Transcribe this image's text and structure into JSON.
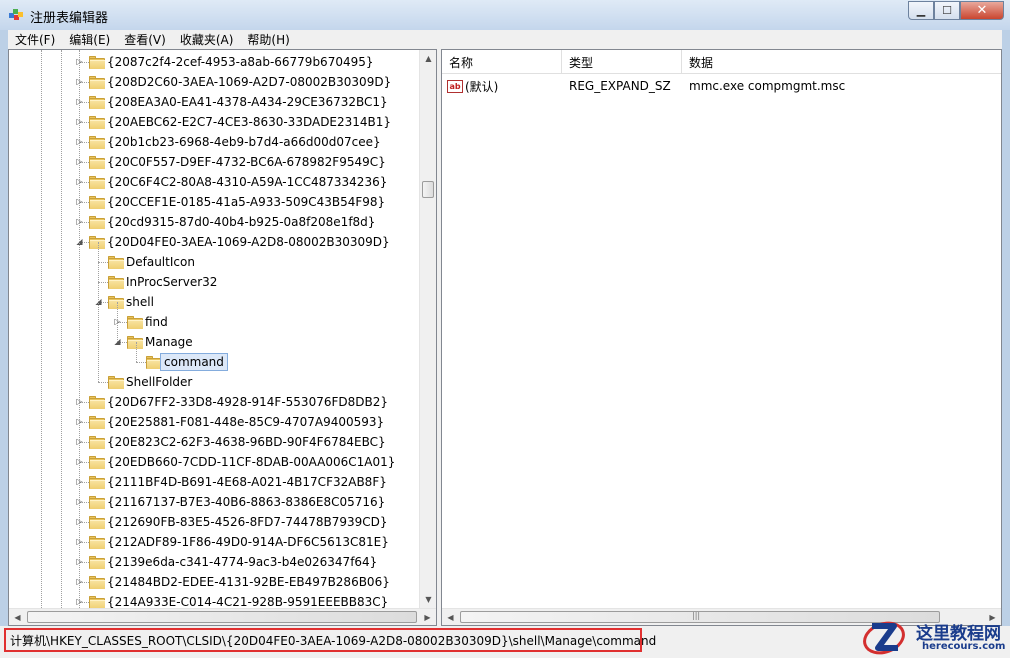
{
  "window": {
    "title": "注册表编辑器",
    "minimize": "▁",
    "maximize": "☐",
    "close": "✕"
  },
  "menu": [
    "文件(F)",
    "编辑(E)",
    "查看(V)",
    "收藏夹(A)",
    "帮助(H)"
  ],
  "tree": {
    "nodes": [
      {
        "label": "{2087c2f4-2cef-4953-a8ab-66779b670495}",
        "level": 0,
        "expander": "collapsed"
      },
      {
        "label": "{208D2C60-3AEA-1069-A2D7-08002B30309D}",
        "level": 0,
        "expander": "collapsed"
      },
      {
        "label": "{208EA3A0-EA41-4378-A434-29CE36732BC1}",
        "level": 0,
        "expander": "collapsed"
      },
      {
        "label": "{20AEBC62-E2C7-4CE3-8630-33DADE2314B1}",
        "level": 0,
        "expander": "collapsed"
      },
      {
        "label": "{20b1cb23-6968-4eb9-b7d4-a66d00d07cee}",
        "level": 0,
        "expander": "collapsed"
      },
      {
        "label": "{20C0F557-D9EF-4732-BC6A-678982F9549C}",
        "level": 0,
        "expander": "collapsed"
      },
      {
        "label": "{20C6F4C2-80A8-4310-A59A-1CC487334236}",
        "level": 0,
        "expander": "collapsed"
      },
      {
        "label": "{20CCEF1E-0185-41a5-A933-509C43B54F98}",
        "level": 0,
        "expander": "collapsed"
      },
      {
        "label": "{20cd9315-87d0-40b4-b925-0a8f208e1f8d}",
        "level": 0,
        "expander": "collapsed"
      },
      {
        "label": "{20D04FE0-3AEA-1069-A2D8-08002B30309D}",
        "level": 0,
        "expander": "expanded"
      },
      {
        "label": "DefaultIcon",
        "level": 1,
        "expander": "none"
      },
      {
        "label": "InProcServer32",
        "level": 1,
        "expander": "none"
      },
      {
        "label": "shell",
        "level": 1,
        "expander": "expanded"
      },
      {
        "label": "find",
        "level": 2,
        "expander": "collapsed"
      },
      {
        "label": "Manage",
        "level": 2,
        "expander": "expanded"
      },
      {
        "label": "command",
        "level": 3,
        "expander": "none",
        "selected": true
      },
      {
        "label": "ShellFolder",
        "level": 1,
        "expander": "none"
      },
      {
        "label": "{20D67FF2-33D8-4928-914F-553076FD8DB2}",
        "level": 0,
        "expander": "collapsed"
      },
      {
        "label": "{20E25881-F081-448e-85C9-4707A9400593}",
        "level": 0,
        "expander": "collapsed"
      },
      {
        "label": "{20E823C2-62F3-4638-96BD-90F4F6784EBC}",
        "level": 0,
        "expander": "collapsed"
      },
      {
        "label": "{20EDB660-7CDD-11CF-8DAB-00AA006C1A01}",
        "level": 0,
        "expander": "collapsed"
      },
      {
        "label": "{2111BF4D-B691-4E68-A021-4B17CF32AB8F}",
        "level": 0,
        "expander": "collapsed"
      },
      {
        "label": "{21167137-B7E3-40B6-8863-8386E8C05716}",
        "level": 0,
        "expander": "collapsed"
      },
      {
        "label": "{212690FB-83E5-4526-8FD7-74478B7939CD}",
        "level": 0,
        "expander": "collapsed"
      },
      {
        "label": "{212ADF89-1F86-49D0-914A-DF6C5613C81E}",
        "level": 0,
        "expander": "collapsed"
      },
      {
        "label": "{2139e6da-c341-4774-9ac3-b4e026347f64}",
        "level": 0,
        "expander": "collapsed"
      },
      {
        "label": "{21484BD2-EDEE-4131-92BE-EB497B286B06}",
        "level": 0,
        "expander": "collapsed"
      },
      {
        "label": "{214A933E-C014-4C21-928B-9591EEEBB83C}",
        "level": 0,
        "expander": "collapsed"
      }
    ]
  },
  "list": {
    "columns": [
      "名称",
      "类型",
      "数据"
    ],
    "rows": [
      {
        "name": "(默认)",
        "type": "REG_EXPAND_SZ",
        "data": "mmc.exe compmgmt.msc",
        "icon": "ab"
      }
    ]
  },
  "status": {
    "path": "计算机\\HKEY_CLASSES_ROOT\\CLSID\\{20D04FE0-3AEA-1069-A2D8-08002B30309D}\\shell\\Manage\\command"
  },
  "watermark": {
    "title": "这里教程网",
    "subtitle": "herecours.com"
  },
  "colors": {
    "selection_bg": "#dce8f8",
    "status_highlight": "#e03030",
    "folder": "#e8c35c"
  }
}
